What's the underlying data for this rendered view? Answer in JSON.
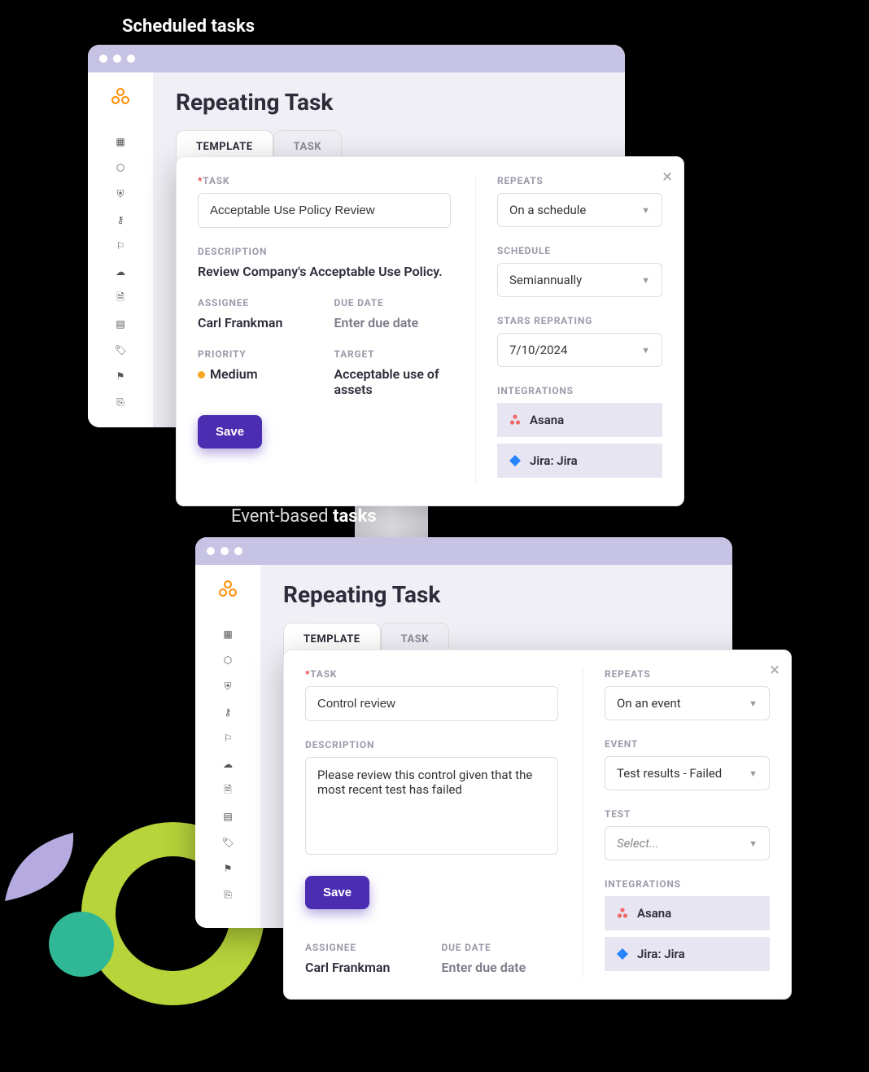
{
  "labels": {
    "scheduled": "Scheduled tasks",
    "event_based_prefix": "Event-based ",
    "event_based_bold": "tasks"
  },
  "window1": {
    "title": "Repeating Task",
    "tabs": {
      "template": "TEMPLATE",
      "task": "TASK"
    },
    "panel": {
      "task_label": "TASK",
      "task_value": "Acceptable Use Policy Review",
      "desc_label": "DESCRIPTION",
      "desc_value": "Review Company's Acceptable Use Policy.",
      "assignee_label": "ASSIGNEE",
      "assignee_value": "Carl Frankman",
      "duedate_label": "DUE DATE",
      "duedate_value": "Enter due date",
      "priority_label": "PRIORITY",
      "priority_value": "Medium",
      "target_label": "TARGET",
      "target_value": "Acceptable use of assets",
      "save": "Save",
      "repeats_label": "REPEATS",
      "repeats_value": "On a schedule",
      "schedule_label": "SCHEDULE",
      "schedule_value": "Semiannually",
      "starts_label": "STARS REPRATING",
      "starts_value": "7/10/2024",
      "integrations_label": "INTEGRATIONS",
      "integrations": [
        "Asana",
        "Jira: Jira"
      ]
    }
  },
  "window2": {
    "title": "Repeating Task",
    "tabs": {
      "template": "TEMPLATE",
      "task": "TASK"
    },
    "panel": {
      "task_label": "TASK",
      "task_value": "Control review",
      "desc_label": "DESCRIPTION",
      "desc_value": "Please review this control given that the most recent test has failed",
      "assignee_label": "ASSIGNEE",
      "assignee_value": "Carl Frankman",
      "duedate_label": "DUE DATE",
      "duedate_value": "Enter due date",
      "save": "Save",
      "repeats_label": "REPEATS",
      "repeats_value": "On an event",
      "event_label": "EVENT",
      "event_value": "Test results - Failed",
      "test_label": "TEST",
      "test_value": "Select...",
      "integrations_label": "INTEGRATIONS",
      "integrations": [
        "Asana",
        "Jira: Jira"
      ]
    }
  }
}
